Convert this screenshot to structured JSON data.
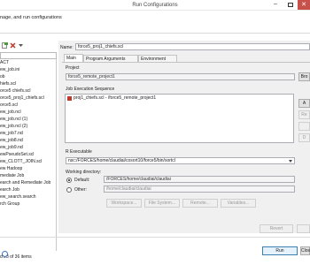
{
  "window": {
    "title": "Run Configurations",
    "subtitle": "nage, and run configurations",
    "close_glyph": "✕",
    "min_glyph": "–"
  },
  "toolbar": {
    "icons": [
      "new-config-icon",
      "duplicate-icon",
      "delete-icon",
      "filter-icon",
      "collapse-icon"
    ]
  },
  "tree": {
    "items": [
      "ACT",
      "ew_job.ini",
      "ob",
      "hiefs.scl",
      "orce5 chiefs.scl",
      "orce5_proj1_chiefs.scl",
      "orce5.scl",
      "ew_job.ncl",
      "ew_job.ncl (1)",
      "ew_job.ncl (2)",
      "ew_job7.ncl",
      "ew_job8.ncl",
      "ew_job9.ncl",
      "ewPseudoSet.scl",
      "ew_CLOTT_JOIN.scl",
      "ew Hadoop",
      "mediate Job",
      "earch and Remediate Job",
      "earch Job",
      "ew_search.search",
      "rch Group"
    ],
    "status": "d 23 of 36 items"
  },
  "form": {
    "name_label": "Name:",
    "name_value": "force5_proj1_chiefs.scl",
    "tabs": [
      "Main",
      "Program Arguments",
      "Environment"
    ],
    "project_label": "Project",
    "project_value": "force5_remote_project1",
    "browse_label": "Bro",
    "sequence_label": "Job Execution Sequence",
    "sequence_items": [
      "proj1_chiefs.scl - /force5_remote_project1"
    ],
    "side_buttons": [
      "A",
      "Re",
      "",
      "D"
    ],
    "executable_label": "R Executable",
    "executable_value": "nsc:/FORCES/home/claudiai/cosort10/force5/bin/sortcl",
    "workdir_label": "Working directory:",
    "default_label": "Default:",
    "default_value": "/FORCES/home/claudiai/claudiai",
    "other_label": "Other:",
    "other_value": "/home/claudiai/claudiai",
    "dir_buttons": [
      "Workspace...",
      "File System...",
      "Remote...",
      "Variables..."
    ],
    "revert_label": "Revert",
    "apply_label": ""
  },
  "footer": {
    "run_label": "Run",
    "close_label": "Close"
  },
  "colors": {
    "close_button": "#c7504b",
    "window_bg": "#f0f0f0"
  }
}
